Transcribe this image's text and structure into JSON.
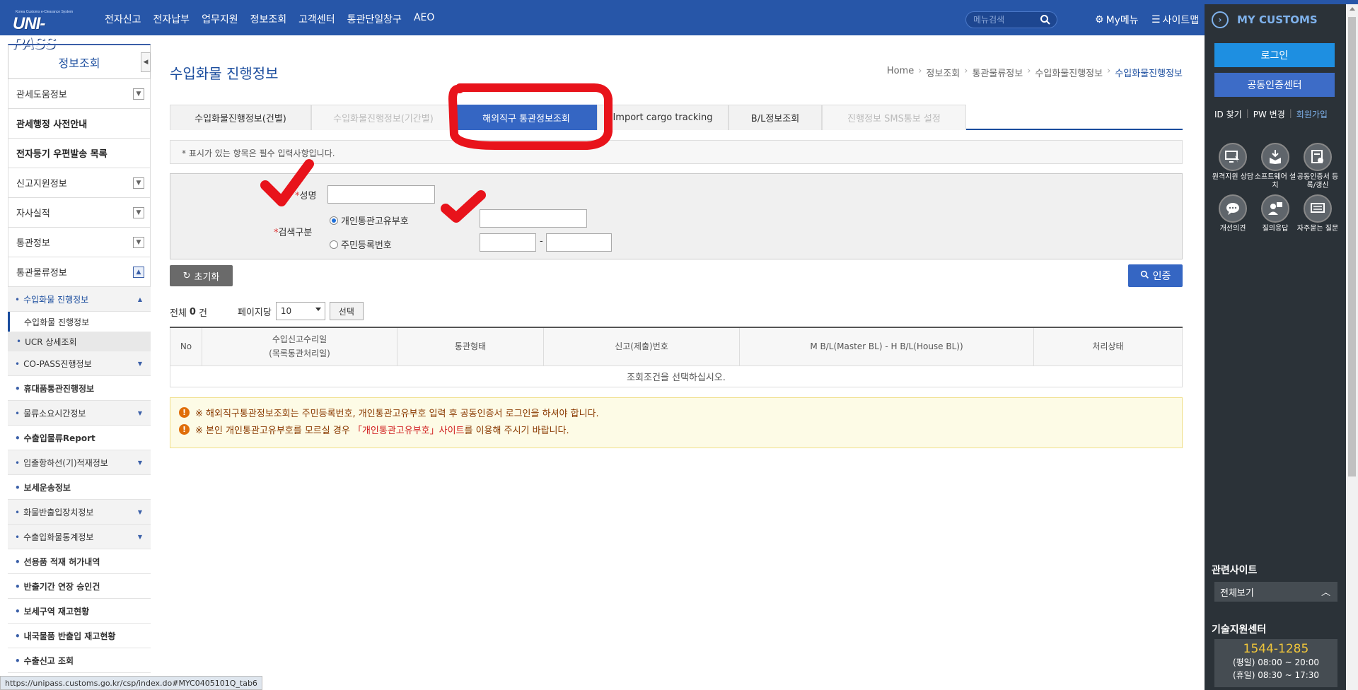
{
  "logo": {
    "sub": "Korea Customs e-Clearance System",
    "main": "UNI-PASS"
  },
  "gnb": [
    "전자신고",
    "전자납부",
    "업무지원",
    "정보조회",
    "고객센터",
    "통관단일창구",
    "AEO"
  ],
  "header": {
    "search_placeholder": "메뉴검색",
    "mymenu": "My메뉴",
    "sitemap": "사이트맵"
  },
  "right": {
    "title": "MY CUSTOMS",
    "login": "로그인",
    "cert_center": "공동인증센터",
    "id_find": "ID 찾기",
    "pw_change": "PW 변경",
    "join": "회원가입",
    "icons": [
      "원격지원 상담",
      "소프트웨어 설치",
      "공동인증서 등록/갱신",
      "개선의견",
      "질의응답",
      "자주묻는 질문"
    ],
    "related_title": "관련사이트",
    "related_select": "전체보기",
    "tech_title": "기술지원센터",
    "tech_phone": "1544-1285",
    "tech_weekday": "(평일) 08:00 ~ 20:00",
    "tech_holiday": "(휴일) 08:30 ~ 17:30"
  },
  "lnb": {
    "title": "정보조회",
    "items": [
      {
        "label": "관세도움정보",
        "toggle": true,
        "bold": false
      },
      {
        "label": "관세행정 사전안내",
        "toggle": false,
        "bold": true
      },
      {
        "label": "전자등기 우편발송 목록",
        "toggle": false,
        "bold": true
      },
      {
        "label": "신고지원정보",
        "toggle": true,
        "bold": false
      },
      {
        "label": "자사실적",
        "toggle": true,
        "bold": false
      },
      {
        "label": "통관정보",
        "toggle": true,
        "bold": false
      },
      {
        "label": "통관물류정보",
        "toggle": true,
        "bold": false
      }
    ],
    "sub_active": "수입화물 진행정보",
    "sub3": [
      "수입화물 진행정보",
      "UCR 상세조회"
    ],
    "subs": [
      {
        "label": "CO-PASS진행정보",
        "dn": true
      },
      {
        "label": "휴대품통관진행정보",
        "dn": false
      },
      {
        "label": "물류소요시간정보",
        "dn": true
      },
      {
        "label": "수출입물류Report",
        "dn": false
      },
      {
        "label": "입출항하선(기)적재정보",
        "dn": true
      },
      {
        "label": "보세운송정보",
        "dn": false
      },
      {
        "label": "화물반출입장치정보",
        "dn": true
      },
      {
        "label": "수출입화물통계정보",
        "dn": true
      },
      {
        "label": "선용품 적재 허가내역",
        "dn": false
      },
      {
        "label": "반출기간 연장 승인건",
        "dn": false
      },
      {
        "label": "보세구역 재고현황",
        "dn": false
      },
      {
        "label": "내국물품 반출입 재고현황",
        "dn": false
      },
      {
        "label": "수출신고 조회",
        "dn": false
      }
    ]
  },
  "main": {
    "title": "수입화물 진행정보",
    "breadcrumb": [
      "Home",
      "정보조회",
      "통관물류정보",
      "수입화물진행정보",
      "수입화물진행정보"
    ],
    "tabs": [
      "수입화물진행정보(건별)",
      "수입화물진행정보(기간별)",
      "해외직구 통관정보조회",
      "Import cargo tracking",
      "B/L정보조회",
      "진행정보 SMS통보 설정"
    ],
    "notice": "* 표시가 있는 항목은 필수 입력사항입니다.",
    "name_label": "성명",
    "search_label": "검색구분",
    "radio1": "개인통관고유부호",
    "radio2": "주민등록번호",
    "dash": "-",
    "reset": "초기화",
    "auth": "인증",
    "total_prefix": "전체",
    "total_count": "0",
    "total_suffix": "건",
    "per_page": "페이지당",
    "per_page_value": "10",
    "select_btn": "선택",
    "cols": [
      "No",
      "수입신고수리일",
      "(목록통관처리일)",
      "통관형태",
      "신고(제출)번호",
      "M B/L(Master BL) - H B/L(House BL))",
      "처리상태"
    ],
    "empty": "조회조건을 선택하십시오.",
    "warn1": "※ 해외직구통관정보조회는 주민등록번호, 개인통관고유부호 입력 후 공동인증서 로그인을 하셔야 합니다.",
    "warn2_a": "※ 본인 개인통관고유부호를 모르실 경우",
    "warn2_link": "「개인통관고유부호」사이트",
    "warn2_b": "를 이용해 주시기 바랍니다."
  },
  "status_url": "https://unipass.customs.go.kr/csp/index.do#MYC0405101Q_tab6",
  "colors": {
    "header": "#2756a8",
    "accent": "#3566c3",
    "annotation": "#e8131b"
  }
}
